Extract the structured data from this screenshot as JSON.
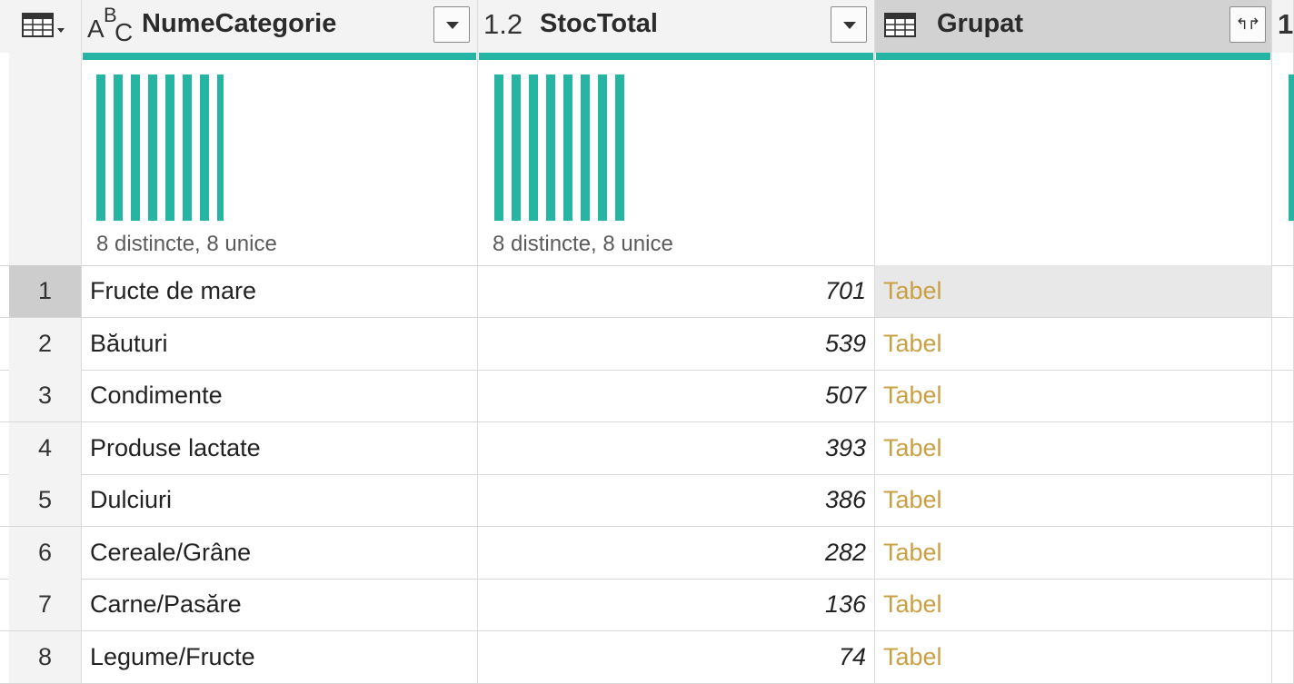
{
  "header": {
    "columns": [
      {
        "type_label": "",
        "name": "NumeCategorie"
      },
      {
        "type_label": "1.2",
        "name": "StocTotal"
      },
      {
        "type_label": "",
        "name": "Grupat"
      }
    ],
    "next_column_cut_label": "1"
  },
  "profile": {
    "col1_stats": "8 distincte, 8 unice",
    "col2_stats": "8 distincte, 8 unice"
  },
  "colors": {
    "quality_bar": "#27b5a3",
    "table_link": "#c9a043"
  },
  "rows": [
    {
      "index": "1",
      "category": "Fructe de mare",
      "stock": "701",
      "group": "Tabel"
    },
    {
      "index": "2",
      "category": "Băuturi",
      "stock": "539",
      "group": "Tabel"
    },
    {
      "index": "3",
      "category": "Condimente",
      "stock": "507",
      "group": "Tabel"
    },
    {
      "index": "4",
      "category": "Produse lactate",
      "stock": "393",
      "group": "Tabel"
    },
    {
      "index": "5",
      "category": "Dulciuri",
      "stock": "386",
      "group": "Tabel"
    },
    {
      "index": "6",
      "category": "Cereale/Grâne",
      "stock": "282",
      "group": "Tabel"
    },
    {
      "index": "7",
      "category": "Carne/Pasăre",
      "stock": "136",
      "group": "Tabel"
    },
    {
      "index": "8",
      "category": "Legume/Fructe",
      "stock": "74",
      "group": "Tabel"
    }
  ],
  "selected_row": 0
}
